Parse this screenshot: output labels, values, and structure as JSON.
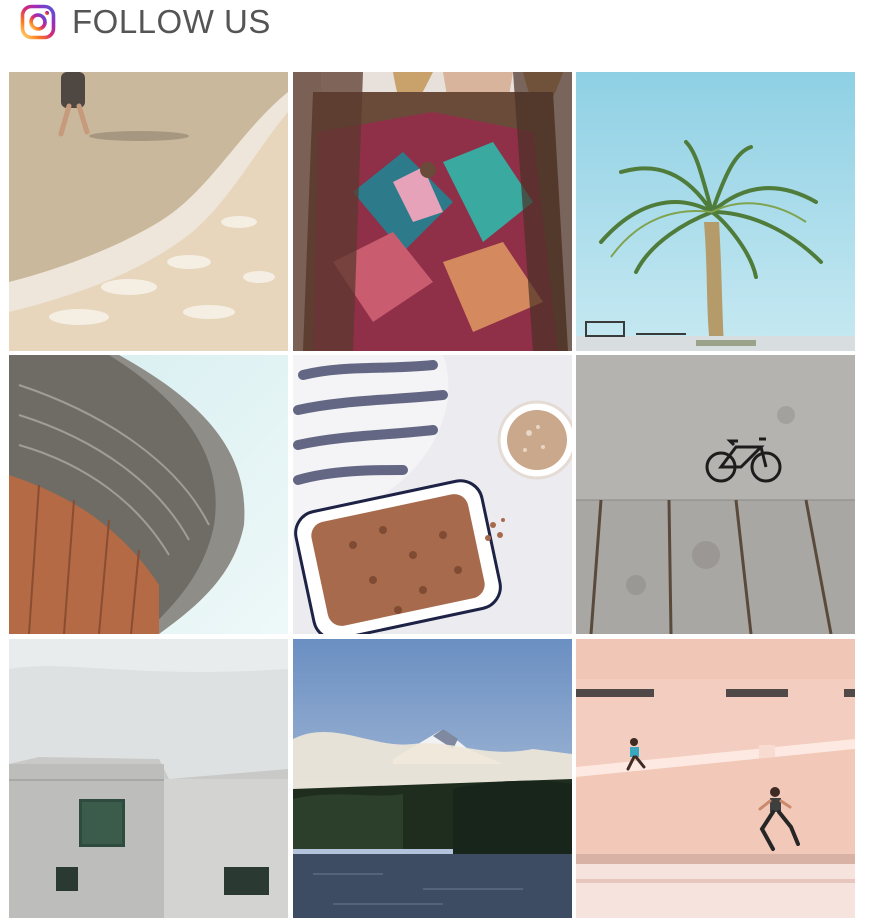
{
  "header": {
    "title": "FOLLOW US",
    "icon": "instagram-icon"
  },
  "gallery": {
    "tiles": [
      {
        "name": "beach-photo-tile"
      },
      {
        "name": "poncho-photo-tile"
      },
      {
        "name": "palm-tree-photo-tile"
      },
      {
        "name": "architecture-photo-tile"
      },
      {
        "name": "granola-photo-tile"
      },
      {
        "name": "bicycle-photo-tile"
      },
      {
        "name": "building-photo-tile"
      },
      {
        "name": "mountain-lake-photo-tile"
      },
      {
        "name": "runners-photo-tile"
      }
    ]
  },
  "colors": {
    "instagram_gradient": [
      "#feda75",
      "#fa7e1e",
      "#d62976",
      "#962fbf",
      "#4f5bd5"
    ],
    "title_text": "#555555"
  }
}
